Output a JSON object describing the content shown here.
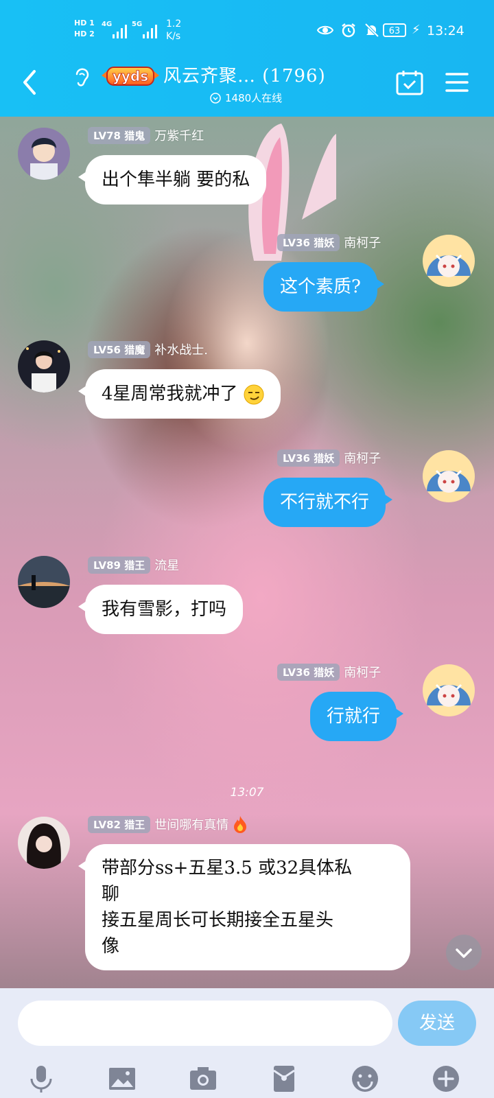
{
  "status_bar": {
    "sim1": "HD 1",
    "sim2": "HD 2",
    "net1": "4G",
    "net2": "5G",
    "speed_value": "1.2",
    "speed_unit": "K/s",
    "battery": "63",
    "time": "13:24"
  },
  "header": {
    "logo_text": "yyds",
    "title": "风云齐聚… (1796)",
    "online": "1480人在线"
  },
  "messages": [
    {
      "side": "left",
      "level": "LV78",
      "rank": "猎鬼",
      "name": "万紫千红",
      "text": "出个隼半躺 要的私"
    },
    {
      "side": "right",
      "level": "LV36",
      "rank": "猎妖",
      "name": "南柯子",
      "text": "这个素质?"
    },
    {
      "side": "left",
      "level": "LV56",
      "rank": "猎魔",
      "name": "补水战士.",
      "text": "4星周常我就冲了"
    },
    {
      "side": "right",
      "level": "LV36",
      "rank": "猎妖",
      "name": "南柯子",
      "text": "不行就不行"
    },
    {
      "side": "left",
      "level": "LV89",
      "rank": "猎王",
      "name": "流星",
      "text": "我有雪影，打吗"
    },
    {
      "side": "right",
      "level": "LV36",
      "rank": "猎妖",
      "name": "南柯子",
      "text": "行就行"
    },
    {
      "side": "left",
      "level": "LV82",
      "rank": "猎王",
      "name": "世间哪有真情",
      "lines": [
        "带部分ss+五星3.5 或32具体私",
        "聊",
        "接五星周长可长期接全五星头",
        "像"
      ]
    }
  ],
  "timestamp": "13:07",
  "input": {
    "placeholder": "",
    "send_label": "发送"
  },
  "toolbar_icons": [
    "microphone-icon",
    "image-icon",
    "camera-icon",
    "red-packet-icon",
    "emoji-icon",
    "plus-icon"
  ]
}
